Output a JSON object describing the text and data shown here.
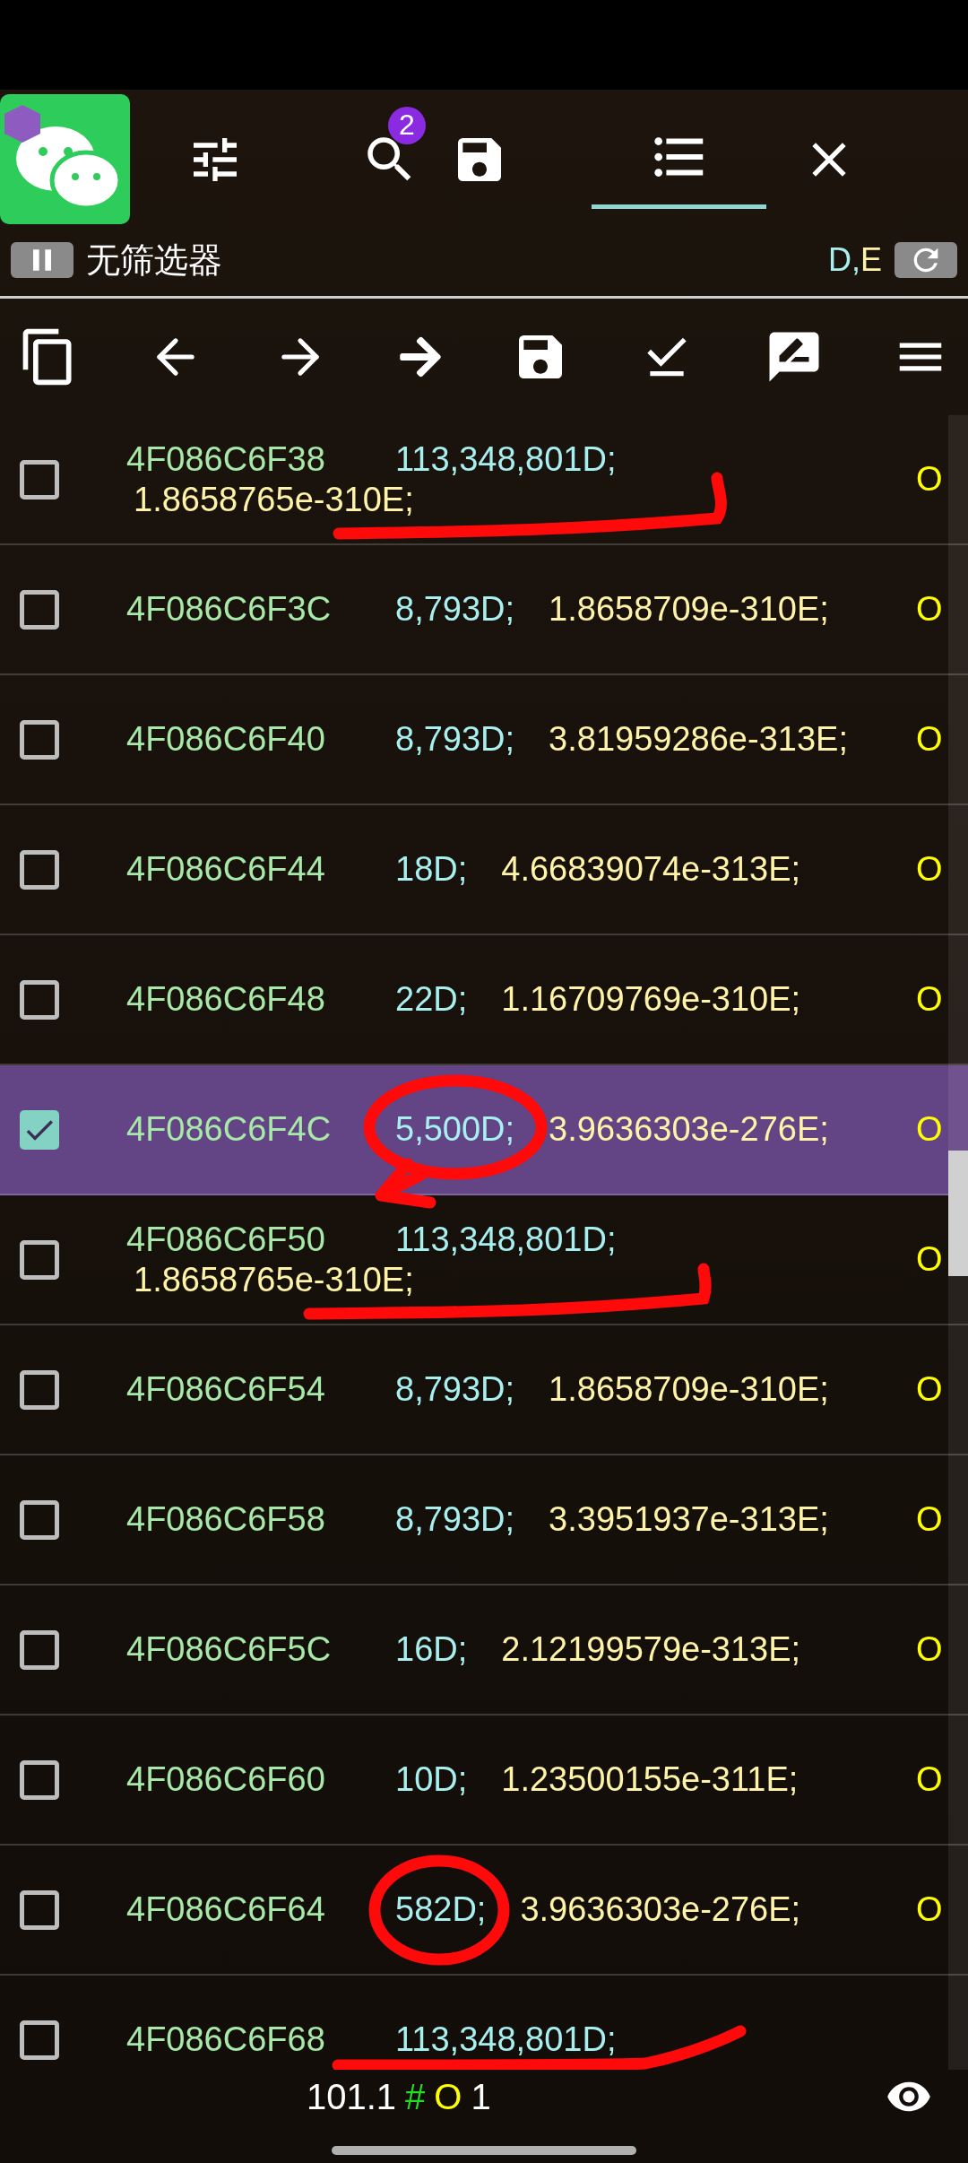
{
  "toolbar": {
    "badge": "2"
  },
  "filter_bar": {
    "label": "无筛选器",
    "types": [
      {
        "text": "D",
        "color": "#a8f0f0"
      },
      {
        "text": ",",
        "color": "#a8f0f0"
      },
      {
        "text": "E",
        "color": "#fff3a8"
      }
    ]
  },
  "rows": [
    {
      "address": "4F086C6F38",
      "dword": "113,348,801D;",
      "float": "1.8658765e-310E;",
      "column_4": "O",
      "checked": false
    },
    {
      "address": "4F086C6F3C",
      "dword": "8,793D;",
      "float": "1.8658709e-310E;",
      "column_4": "O",
      "checked": false
    },
    {
      "address": "4F086C6F40",
      "dword": "8,793D;",
      "float": "3.81959286e-313E;",
      "column_4": "O",
      "checked": false
    },
    {
      "address": "4F086C6F44",
      "dword": "18D;",
      "float": "4.66839074e-313E;",
      "column_4": "O",
      "checked": false
    },
    {
      "address": "4F086C6F48",
      "dword": "22D;",
      "float": "1.16709769e-310E;",
      "column_4": "O",
      "checked": false
    },
    {
      "address": "4F086C6F4C",
      "dword": "5,500D;",
      "float": "3.9636303e-276E;",
      "column_4": "O",
      "checked": true
    },
    {
      "address": "4F086C6F50",
      "dword": "113,348,801D;",
      "float": "1.8658765e-310E;",
      "column_4": "O",
      "checked": false
    },
    {
      "address": "4F086C6F54",
      "dword": "8,793D;",
      "float": "1.8658709e-310E;",
      "column_4": "O",
      "checked": false
    },
    {
      "address": "4F086C6F58",
      "dword": "8,793D;",
      "float": "3.3951937e-313E;",
      "column_4": "O",
      "checked": false
    },
    {
      "address": "4F086C6F5C",
      "dword": "16D;",
      "float": "2.12199579e-313E;",
      "column_4": "O",
      "checked": false
    },
    {
      "address": "4F086C6F60",
      "dword": "10D;",
      "float": "1.23500155e-311E;",
      "column_4": "O",
      "checked": false
    },
    {
      "address": "4F086C6F64",
      "dword": "582D;",
      "float": "3.9636303e-276E;",
      "column_4": "O",
      "checked": false
    },
    {
      "address": "4F086C6F68",
      "dword": "113,348,801D;",
      "checked": false
    }
  ],
  "status_bar": {
    "parts": [
      {
        "text": "101.1",
        "color": "#ffffff"
      },
      {
        "text": "#",
        "color": "#22dd22"
      },
      {
        "text": "O",
        "color": "#ffff00"
      },
      {
        "text": "1",
        "color": "#ffffff"
      }
    ]
  }
}
